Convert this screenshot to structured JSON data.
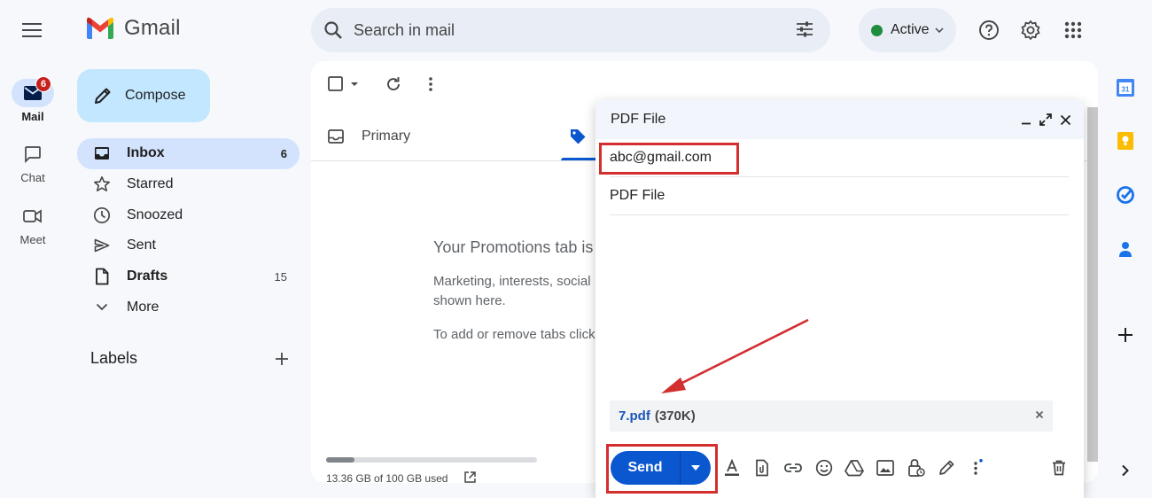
{
  "app": {
    "name": "Gmail"
  },
  "rail": {
    "items": [
      {
        "label": "Mail",
        "icon": "mail-icon",
        "badge": "6",
        "active": true
      },
      {
        "label": "Chat",
        "icon": "chat-icon"
      },
      {
        "label": "Meet",
        "icon": "meet-icon"
      }
    ]
  },
  "search": {
    "placeholder": "Search in mail"
  },
  "status": {
    "label": "Active",
    "color": "#1e8e3e"
  },
  "sidebar": {
    "compose_label": "Compose",
    "items": [
      {
        "label": "Inbox",
        "count": "6",
        "icon": "inbox-icon"
      },
      {
        "label": "Starred",
        "count": "",
        "icon": "star-icon"
      },
      {
        "label": "Snoozed",
        "count": "",
        "icon": "clock-icon"
      },
      {
        "label": "Sent",
        "count": "",
        "icon": "send-icon"
      },
      {
        "label": "Drafts",
        "count": "15",
        "icon": "draft-icon"
      },
      {
        "label": "More",
        "count": "",
        "icon": "chevron-down-icon"
      }
    ],
    "labels_heading": "Labels"
  },
  "main": {
    "tabs": [
      {
        "label": "Primary"
      },
      {
        "label": "Promotions"
      }
    ],
    "empty_title": "Your Promotions tab is e",
    "empty_desc": "Marketing, interests, social shown here.",
    "empty_tip": "To add or remove tabs click",
    "storage": {
      "text": "13.36 GB of 100 GB used",
      "fraction": 0.1336
    }
  },
  "compose": {
    "title": "PDF File",
    "to": "abc@gmail.com",
    "subject": "PDF File",
    "attachment": {
      "name": "7.pdf",
      "size": "(370K)"
    },
    "send_label": "Send"
  },
  "colors": {
    "accent": "#0b57d0",
    "highlight": "#d32f2f",
    "panel_bg": "#f6f8fc"
  }
}
